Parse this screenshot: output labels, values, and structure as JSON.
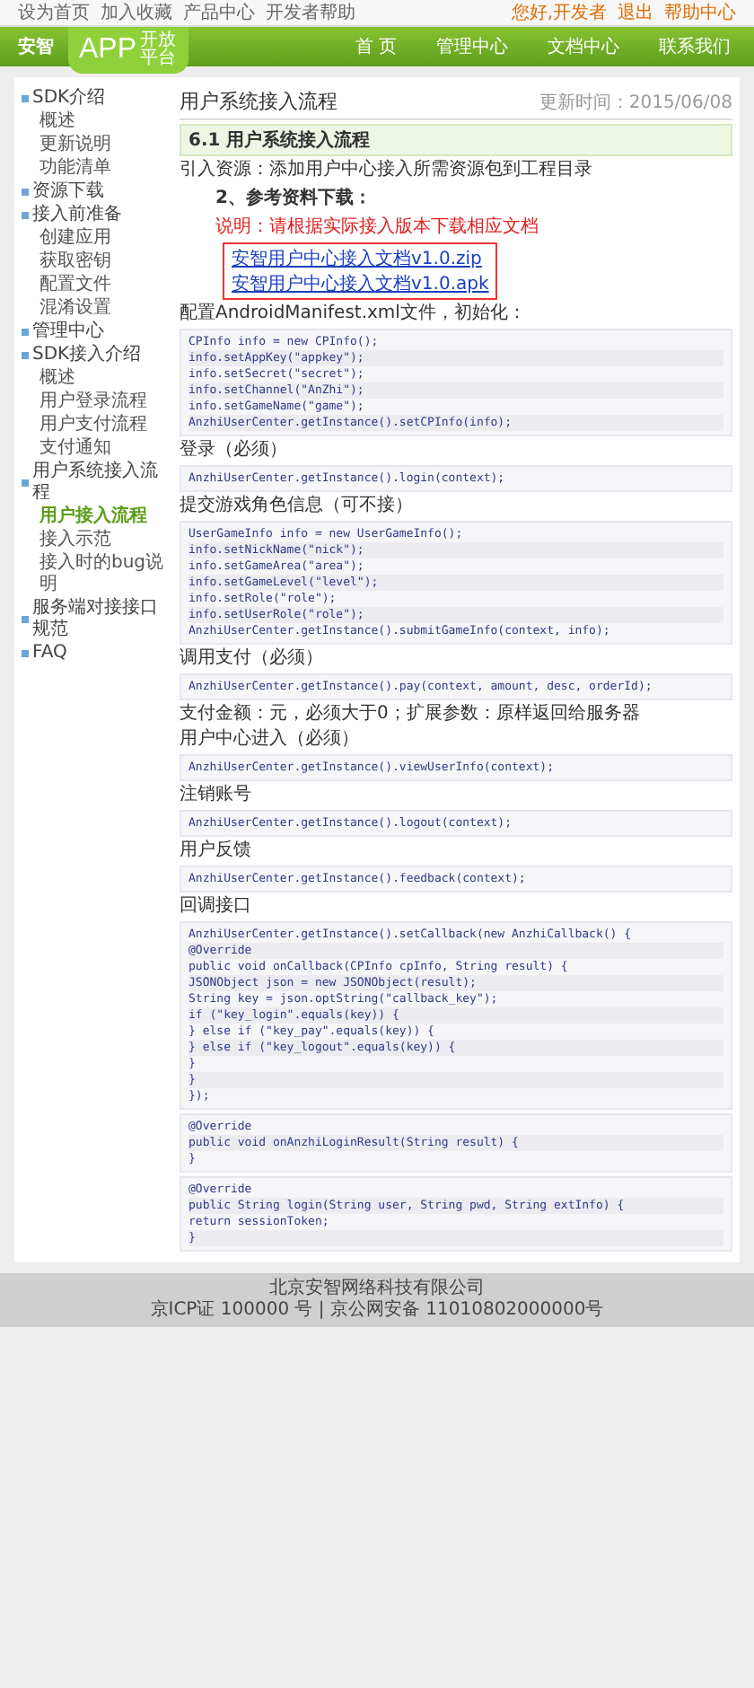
{
  "top_bar": {
    "links": [
      "设为首页",
      "加入收藏",
      "产品中心",
      "开发者帮助"
    ],
    "user_links": [
      "您好,开发者",
      "退出",
      "帮助中心"
    ]
  },
  "nav": {
    "brand": "安智",
    "logo": "APP",
    "logo_sub": "开放平台",
    "items": [
      {
        "label": "首 页",
        "selected": false
      },
      {
        "label": "管理中心",
        "selected": false
      },
      {
        "label": "文档中心",
        "selected": false
      },
      {
        "label": "联系我们",
        "selected": false
      }
    ]
  },
  "sidebar": {
    "items": [
      {
        "label": "SDK介绍",
        "selected": false,
        "children": [
          {
            "label": "概述",
            "selected": false
          },
          {
            "label": "更新说明",
            "selected": false
          },
          {
            "label": "功能清单",
            "selected": false
          }
        ]
      },
      {
        "label": "资源下载",
        "selected": false
      },
      {
        "label": "接入前准备",
        "selected": false,
        "children": [
          {
            "label": "创建应用",
            "selected": false
          },
          {
            "label": "获取密钥",
            "selected": false
          },
          {
            "label": "配置文件",
            "selected": false
          },
          {
            "label": "混淆设置",
            "selected": false
          }
        ]
      },
      {
        "label": "管理中心",
        "selected": false
      },
      {
        "label": "SDK接入介绍",
        "selected": false,
        "children": [
          {
            "label": "概述",
            "selected": false
          },
          {
            "label": "用户登录流程",
            "selected": false
          },
          {
            "label": "用户支付流程",
            "selected": false
          },
          {
            "label": "支付通知",
            "selected": false
          }
        ]
      },
      {
        "label": "用户系统接入流程",
        "selected": false,
        "children": [
          {
            "label": "用户接入流程",
            "selected": true
          },
          {
            "label": "接入示范",
            "selected": false
          },
          {
            "label": "接入时的bug说明",
            "selected": false
          }
        ]
      },
      {
        "label": "服务端对接接口规范",
        "selected": false
      },
      {
        "label": "FAQ",
        "selected": false
      }
    ]
  },
  "page": {
    "title": "用户系统接入流程",
    "updated": "更新时间：2015/06/08"
  },
  "blocks": [
    {
      "kind": "heading",
      "text": "6.1 用户系统接入流程"
    },
    {
      "kind": "para",
      "text": "引入资源：添加用户中心接入所需资源包到工程目录"
    },
    {
      "kind": "strong",
      "text": "2、参考资料下载："
    },
    {
      "kind": "note",
      "text": "说明：请根据实际接入版本下载相应文档"
    },
    {
      "kind": "links",
      "items": [
        "安智用户中心接入文档v1.0.zip",
        "安智用户中心接入文档v1.0.apk"
      ]
    },
    {
      "kind": "para",
      "text": "配置AndroidManifest.xml文件，初始化："
    },
    {
      "kind": "code",
      "lines": [
        "CPInfo info = new CPInfo();",
        "info.setAppKey(\"appkey\");",
        "info.setSecret(\"secret\");",
        "info.setChannel(\"AnZhi\");",
        "info.setGameName(\"game\");",
        "AnzhiUserCenter.getInstance().setCPInfo(info);"
      ]
    },
    {
      "kind": "para",
      "text": "登录（必须）"
    },
    {
      "kind": "code",
      "lines": [
        "AnzhiUserCenter.getInstance().login(context);"
      ]
    },
    {
      "kind": "para",
      "text": "提交游戏角色信息（可不接）"
    },
    {
      "kind": "code",
      "lines": [
        "UserGameInfo info = new UserGameInfo();",
        "info.setNickName(\"nick\");",
        "info.setGameArea(\"area\");",
        "info.setGameLevel(\"level\");",
        "info.setRole(\"role\");",
        "info.setUserRole(\"role\");",
        "AnzhiUserCenter.getInstance().submitGameInfo(context, info);"
      ]
    },
    {
      "kind": "para",
      "text": "调用支付（必须）"
    },
    {
      "kind": "code",
      "lines": [
        "AnzhiUserCenter.getInstance().pay(context, amount, desc, orderId);"
      ]
    },
    {
      "kind": "para",
      "text": "支付金额：元，必须大于0；扩展参数：原样返回给服务器"
    },
    {
      "kind": "para",
      "text": "用户中心进入（必须）"
    },
    {
      "kind": "code",
      "lines": [
        "AnzhiUserCenter.getInstance().viewUserInfo(context);"
      ]
    },
    {
      "kind": "para",
      "text": "注销账号"
    },
    {
      "kind": "code",
      "lines": [
        "AnzhiUserCenter.getInstance().logout(context);"
      ]
    },
    {
      "kind": "para",
      "text": "用户反馈"
    },
    {
      "kind": "code",
      "lines": [
        "AnzhiUserCenter.getInstance().feedback(context);"
      ]
    },
    {
      "kind": "para",
      "text": "回调接口"
    },
    {
      "kind": "code",
      "lines": [
        "AnzhiUserCenter.getInstance().setCallback(new AnzhiCallback() {",
        "@Override",
        "public void onCallback(CPInfo cpInfo, String result) {",
        "JSONObject json = new JSONObject(result);",
        "String key = json.optString(\"callback_key\");",
        "if (\"key_login\".equals(key)) {",
        "} else if (\"key_pay\".equals(key)) {",
        "} else if (\"key_logout\".equals(key)) {",
        "}",
        "}",
        "});"
      ]
    },
    {
      "kind": "code",
      "lines": [
        "@Override",
        "public void onAnzhiLoginResult(String result) {",
        "}"
      ]
    },
    {
      "kind": "code",
      "lines": [
        "@Override",
        "public String login(String user, String pwd, String extInfo) {",
        "return sessionToken;",
        "}"
      ]
    }
  ],
  "footer": {
    "lines": [
      "北京安智网络科技有限公司",
      "京ICP证 100000 号 | 京公网安备 11010802000000号"
    ]
  }
}
